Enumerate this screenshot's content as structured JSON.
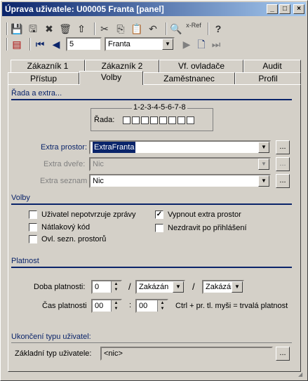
{
  "window": {
    "title": "Úprava uživatele: U00005 Franta [panel]"
  },
  "titlebar_buttons": [
    "_",
    "□",
    "×"
  ],
  "toolbar1": {
    "items": [
      "save-icon",
      "save-as-icon",
      "delete-icon",
      "trash-icon",
      "up-icon",
      "cut-icon",
      "copy-icon",
      "paste-icon",
      "undo-icon",
      "find-icon",
      "x-ref-icon",
      "help-icon"
    ],
    "xref_label": "x-Ref"
  },
  "toolbar2": {
    "record_number": "5",
    "record_name": "Franta"
  },
  "tabs_row1": [
    "Zákazník 1",
    "Zákazník 2",
    "Vf. ovladače",
    "Audit"
  ],
  "tabs_row2": [
    "Přístup",
    "Volby",
    "Zaměstnanec",
    "Profil"
  ],
  "sections": {
    "rada": "Řada a extra...",
    "volby": "Volby",
    "platnost": "Platnost",
    "ukonceni": "Ukončení typu uživatel:"
  },
  "rada": {
    "numbers": "1-2-3-4-5-6-7-8",
    "label": "Řada:"
  },
  "extra": {
    "prostor_label": "Extra prostor:",
    "prostor_value": "ExtraFranta",
    "dvere_label": "Extra dveře:",
    "dvere_value": "Nic",
    "seznam_label": "Extra seznam",
    "seznam_value": "Nic",
    "dots": "..."
  },
  "volby": {
    "nepotvrzuje": "Uživatel nepotvrzuje zprávy",
    "natlakovy": "Nátlakový kód",
    "ovl_sezn": "Ovl. sezn. prostorů",
    "vypnout": "Vypnout extra prostor",
    "nezdravit": "Nezdravit po přihlášení",
    "check_mark": "✓"
  },
  "platnost": {
    "doba_label": "Doba platnosti:",
    "doba_value": "0",
    "slash": "/",
    "doba_combo1": "Zakázán",
    "doba_combo2": "Zakázán",
    "cas_label": "Čas platnosti",
    "cas_hours": "00",
    "colon": ":",
    "cas_minutes": "00",
    "hint": "Ctrl + pr. tl. myši = trvalá platnost"
  },
  "zakladni": {
    "label": "Základní typ uživatele:",
    "value": "<nic>",
    "dots": "..."
  }
}
